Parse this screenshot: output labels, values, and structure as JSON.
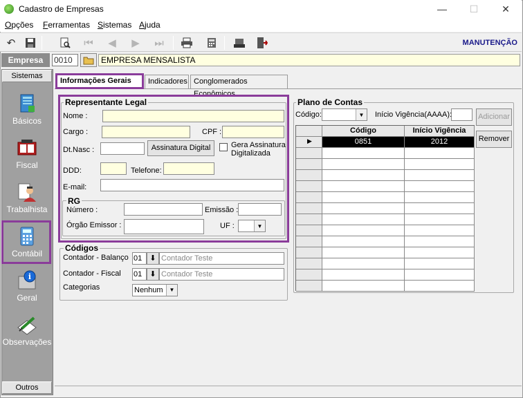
{
  "window": {
    "title": "Cadastro de Empresas",
    "min": "—",
    "max": "☐",
    "close": "✕"
  },
  "menu": {
    "items": [
      "Opções",
      "Ferramentas",
      "Sistemas",
      "Ajuda"
    ]
  },
  "toolbar": {
    "mode_label": "MANUTENÇÃO"
  },
  "empresa": {
    "label": "Empresa",
    "code": "0010",
    "name": "EMPRESA MENSALISTA"
  },
  "sidebar": {
    "header": "Sistemas",
    "footer": "Outros",
    "items": [
      {
        "label": "Básicos",
        "icon": "book-icon"
      },
      {
        "label": "Fiscal",
        "icon": "ledger-icon"
      },
      {
        "label": "Trabalhista",
        "icon": "worker-icon"
      },
      {
        "label": "Contábil",
        "icon": "calculator-icon"
      },
      {
        "label": "Geral",
        "icon": "info-icon"
      },
      {
        "label": "Observações",
        "icon": "notes-icon"
      }
    ]
  },
  "tabs": [
    "Informações Gerais",
    "Indicadores",
    "Conglomerados Econômicos"
  ],
  "representante": {
    "title": "Representante Legal",
    "nome_label": "Nome :",
    "cargo_label": "Cargo :",
    "cpf_label": "CPF :",
    "dtnasc_label": "Dt.Nasc :",
    "assinatura_button": "Assinatura Digital",
    "gera_label": "Gera Assinatura Digitalizada",
    "ddd_label": "DDD:",
    "telefone_label": "Telefone:",
    "email_label": "E-mail:",
    "rg": {
      "title": "RG",
      "numero_label": "Número :",
      "emissao_label": "Emissão :",
      "orgao_label": "Órgão Emissor :",
      "uf_label": "UF :"
    }
  },
  "codigos": {
    "title": "Códigos",
    "balanco_label": "Contador - Balanço",
    "balanco_code": "01",
    "balanco_value": "Contador Teste",
    "fiscal_label": "Contador - Fiscal",
    "fiscal_code": "01",
    "fiscal_value": "Contador Teste",
    "categorias_label": "Categorias",
    "categorias_value": "Nenhum"
  },
  "plano": {
    "title": "Plano de Contas",
    "codigo_label": "Código:",
    "vigencia_label": "Início Vigência(AAAA):",
    "adicionar_button": "Adicionar",
    "remover_button": "Remover",
    "columns": [
      "Código",
      "Início Vigência"
    ],
    "rows": [
      {
        "codigo": "0851",
        "vigencia": "2012"
      }
    ]
  },
  "colors": {
    "highlight": "#8a3c9a",
    "required_field": "#ffffe0",
    "sidebar": "#a0a0a0"
  }
}
